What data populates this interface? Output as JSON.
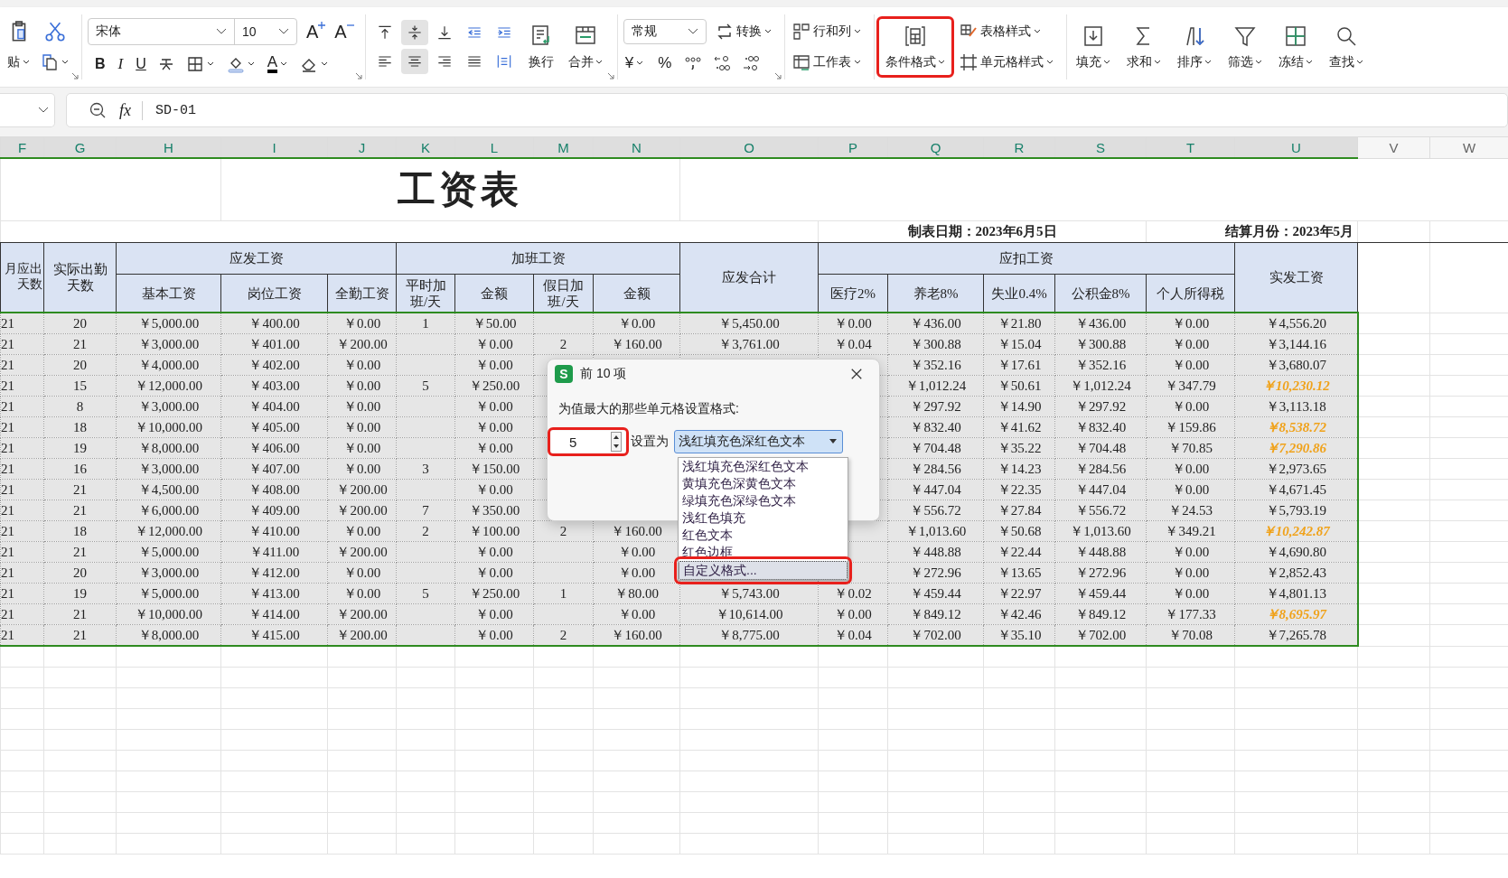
{
  "ribbon": {
    "paste": "贴",
    "font": {
      "name": "宋体",
      "size": "10",
      "grow": "A",
      "shrink": "A",
      "bold": "B",
      "italic": "I",
      "underline": "U",
      "color_letter": "A"
    },
    "align_buttons": [
      {
        "kind": "top",
        "selected": false
      },
      {
        "kind": "middle",
        "selected": true
      },
      {
        "kind": "bottom",
        "selected": false
      },
      {
        "kind": "outdent",
        "selected": false
      },
      {
        "kind": "indent",
        "selected": false
      },
      {
        "kind": "left",
        "selected": false
      },
      {
        "kind": "center",
        "selected": true
      },
      {
        "kind": "right",
        "selected": false
      },
      {
        "kind": "justify",
        "selected": false
      },
      {
        "kind": "distribute",
        "selected": false
      }
    ],
    "wrap": "换行",
    "merge": "合并",
    "number": {
      "format": "常规",
      "convert": "转换",
      "currency": "¥",
      "percent": "%"
    },
    "rows_cols": "行和列",
    "worksheet": "工作表",
    "conditional": {
      "label": "条件格式",
      "annotated": true
    },
    "table_style": "表格样式",
    "cell_style": "单元格样式",
    "tools": [
      {
        "kind": "fill",
        "label": "填充"
      },
      {
        "kind": "sum",
        "label": "求和"
      },
      {
        "kind": "sort",
        "label": "排序"
      },
      {
        "kind": "filter",
        "label": "筛选"
      },
      {
        "kind": "freeze",
        "label": "冻结"
      },
      {
        "kind": "find",
        "label": "查找"
      }
    ]
  },
  "formula_bar": {
    "fx": "fx",
    "value": "SD-01"
  },
  "sheet": {
    "columns": [
      {
        "label": "F",
        "selected": true
      },
      {
        "label": "G",
        "selected": true
      },
      {
        "label": "H",
        "selected": true
      },
      {
        "label": "I",
        "selected": true
      },
      {
        "label": "J",
        "selected": true
      },
      {
        "label": "K",
        "selected": true
      },
      {
        "label": "L",
        "selected": true
      },
      {
        "label": "M",
        "selected": true
      },
      {
        "label": "N",
        "selected": true
      },
      {
        "label": "O",
        "selected": true
      },
      {
        "label": "P",
        "selected": true
      },
      {
        "label": "Q",
        "selected": true
      },
      {
        "label": "R",
        "selected": true
      },
      {
        "label": "S",
        "selected": true
      },
      {
        "label": "T",
        "selected": true
      },
      {
        "label": "U",
        "selected": true
      },
      {
        "label": "V",
        "selected": false
      },
      {
        "label": "W",
        "selected": false
      }
    ],
    "title": "工资表",
    "made_date": "制表日期：2023年6月5日",
    "settle_month": "结算月份：2023年5月",
    "header_groups": [
      "月应出天数",
      "实际出勤天数",
      "应发工资",
      "加班工资",
      "应发合计",
      "应扣工资",
      "实发工资"
    ],
    "sub_headers": [
      "基本工资",
      "岗位工资",
      "全勤工资",
      "平时加班/天",
      "金额",
      "假日加班/天",
      "金额",
      "医疗2%",
      "养老8%",
      "失业0.4%",
      "公积金8%",
      "个人所得税"
    ],
    "rows": [
      {
        "highlighted": false,
        "cells": [
          "21",
          "20",
          "￥5,000.00",
          "￥400.00",
          "￥0.00",
          "1",
          "￥50.00",
          null,
          "￥0.00",
          "￥5,450.00",
          "￥0.00",
          "￥436.00",
          "￥21.80",
          "￥436.00",
          "￥0.00",
          "￥4,556.20"
        ]
      },
      {
        "highlighted": false,
        "cells": [
          "21",
          "21",
          "￥3,000.00",
          "￥401.00",
          "￥200.00",
          null,
          "￥0.00",
          "2",
          "￥160.00",
          "￥3,761.00",
          "￥0.04",
          "￥300.88",
          "￥15.04",
          "￥300.88",
          "￥0.00",
          "￥3,144.16"
        ]
      },
      {
        "highlighted": false,
        "cells": [
          "21",
          "20",
          "￥4,000.00",
          "￥402.00",
          "￥0.00",
          null,
          "￥0.00",
          null,
          null,
          null,
          null,
          "￥352.16",
          "￥17.61",
          "￥352.16",
          "￥0.00",
          "￥3,680.07"
        ]
      },
      {
        "highlighted": true,
        "cells": [
          "21",
          "15",
          "￥12,000.00",
          "￥403.00",
          "￥0.00",
          "5",
          "￥250.00",
          null,
          null,
          null,
          null,
          "￥1,012.24",
          "￥50.61",
          "￥1,012.24",
          "￥347.79",
          "￥10,230.12"
        ]
      },
      {
        "highlighted": false,
        "cells": [
          "21",
          "8",
          "￥3,000.00",
          "￥404.00",
          "￥0.00",
          null,
          "￥0.00",
          null,
          null,
          null,
          null,
          "￥297.92",
          "￥14.90",
          "￥297.92",
          "￥0.00",
          "￥3,113.18"
        ]
      },
      {
        "highlighted": true,
        "cells": [
          "21",
          "18",
          "￥10,000.00",
          "￥405.00",
          "￥0.00",
          null,
          "￥0.00",
          null,
          null,
          null,
          null,
          "￥832.40",
          "￥41.62",
          "￥832.40",
          "￥159.86",
          "￥8,538.72"
        ]
      },
      {
        "highlighted": true,
        "cells": [
          "21",
          "19",
          "￥8,000.00",
          "￥406.00",
          "￥0.00",
          null,
          "￥0.00",
          null,
          null,
          null,
          null,
          "￥704.48",
          "￥35.22",
          "￥704.48",
          "￥70.85",
          "￥7,290.86"
        ]
      },
      {
        "highlighted": false,
        "cells": [
          "21",
          "16",
          "￥3,000.00",
          "￥407.00",
          "￥0.00",
          "3",
          "￥150.00",
          null,
          null,
          null,
          null,
          "￥284.56",
          "￥14.23",
          "￥284.56",
          "￥0.00",
          "￥2,973.65"
        ]
      },
      {
        "highlighted": false,
        "cells": [
          "21",
          "21",
          "￥4,500.00",
          "￥408.00",
          "￥200.00",
          null,
          "￥0.00",
          null,
          null,
          null,
          null,
          "￥447.04",
          "￥22.35",
          "￥447.04",
          "￥0.00",
          "￥4,671.45"
        ]
      },
      {
        "highlighted": false,
        "cells": [
          "21",
          "21",
          "￥6,000.00",
          "￥409.00",
          "￥200.00",
          "7",
          "￥350.00",
          null,
          null,
          null,
          null,
          "￥556.72",
          "￥27.84",
          "￥556.72",
          "￥24.53",
          "￥5,793.19"
        ]
      },
      {
        "highlighted": true,
        "cells": [
          "21",
          "18",
          "￥12,000.00",
          "￥410.00",
          "￥0.00",
          "2",
          "￥100.00",
          "2",
          "￥160.00",
          null,
          null,
          "￥1,013.60",
          "￥50.68",
          "￥1,013.60",
          "￥349.21",
          "￥10,242.87"
        ]
      },
      {
        "highlighted": false,
        "cells": [
          "21",
          "21",
          "￥5,000.00",
          "￥411.00",
          "￥200.00",
          null,
          "￥0.00",
          null,
          "￥0.00",
          null,
          null,
          "￥448.88",
          "￥22.44",
          "￥448.88",
          "￥0.00",
          "￥4,690.80"
        ]
      },
      {
        "highlighted": false,
        "cells": [
          "21",
          "20",
          "￥3,000.00",
          "￥412.00",
          "￥0.00",
          null,
          "￥0.00",
          null,
          "￥0.00",
          null,
          null,
          "￥272.96",
          "￥13.65",
          "￥272.96",
          "￥0.00",
          "￥2,852.43"
        ]
      },
      {
        "highlighted": false,
        "cells": [
          "21",
          "19",
          "￥5,000.00",
          "￥413.00",
          "￥0.00",
          "5",
          "￥250.00",
          "1",
          "￥80.00",
          "￥5,743.00",
          "￥0.02",
          "￥459.44",
          "￥22.97",
          "￥459.44",
          "￥0.00",
          "￥4,801.13"
        ]
      },
      {
        "highlighted": true,
        "cells": [
          "21",
          "21",
          "￥10,000.00",
          "￥414.00",
          "￥200.00",
          null,
          "￥0.00",
          null,
          "￥0.00",
          "￥10,614.00",
          "￥0.00",
          "￥849.12",
          "￥42.46",
          "￥849.12",
          "￥177.33",
          "￥8,695.97"
        ]
      },
      {
        "highlighted": false,
        "cells": [
          "21",
          "21",
          "￥8,000.00",
          "￥415.00",
          "￥200.00",
          null,
          "￥0.00",
          "2",
          "￥160.00",
          "￥8,775.00",
          "￥0.04",
          "￥702.00",
          "￥35.10",
          "￥702.00",
          "￥70.08",
          "￥7,265.78"
        ]
      }
    ]
  },
  "dialog": {
    "logo": "S",
    "title": "前 10 项",
    "prompt": "为值最大的那些单元格设置格式:",
    "count": "5",
    "count_annotated": true,
    "set_label": "设置为",
    "format": "浅红填充色深红色文本",
    "options": [
      {
        "label": "浅红填充色深红色文本",
        "selected": false,
        "annotated": false
      },
      {
        "label": "黄填充色深黄色文本",
        "selected": false,
        "annotated": false
      },
      {
        "label": "绿填充色深绿色文本",
        "selected": false,
        "annotated": false
      },
      {
        "label": "浅红色填充",
        "selected": false,
        "annotated": false
      },
      {
        "label": "红色文本",
        "selected": false,
        "annotated": false
      },
      {
        "label": "红色边框",
        "selected": false,
        "annotated": false
      },
      {
        "label": "自定义格式...",
        "selected": true,
        "annotated": true
      }
    ]
  }
}
